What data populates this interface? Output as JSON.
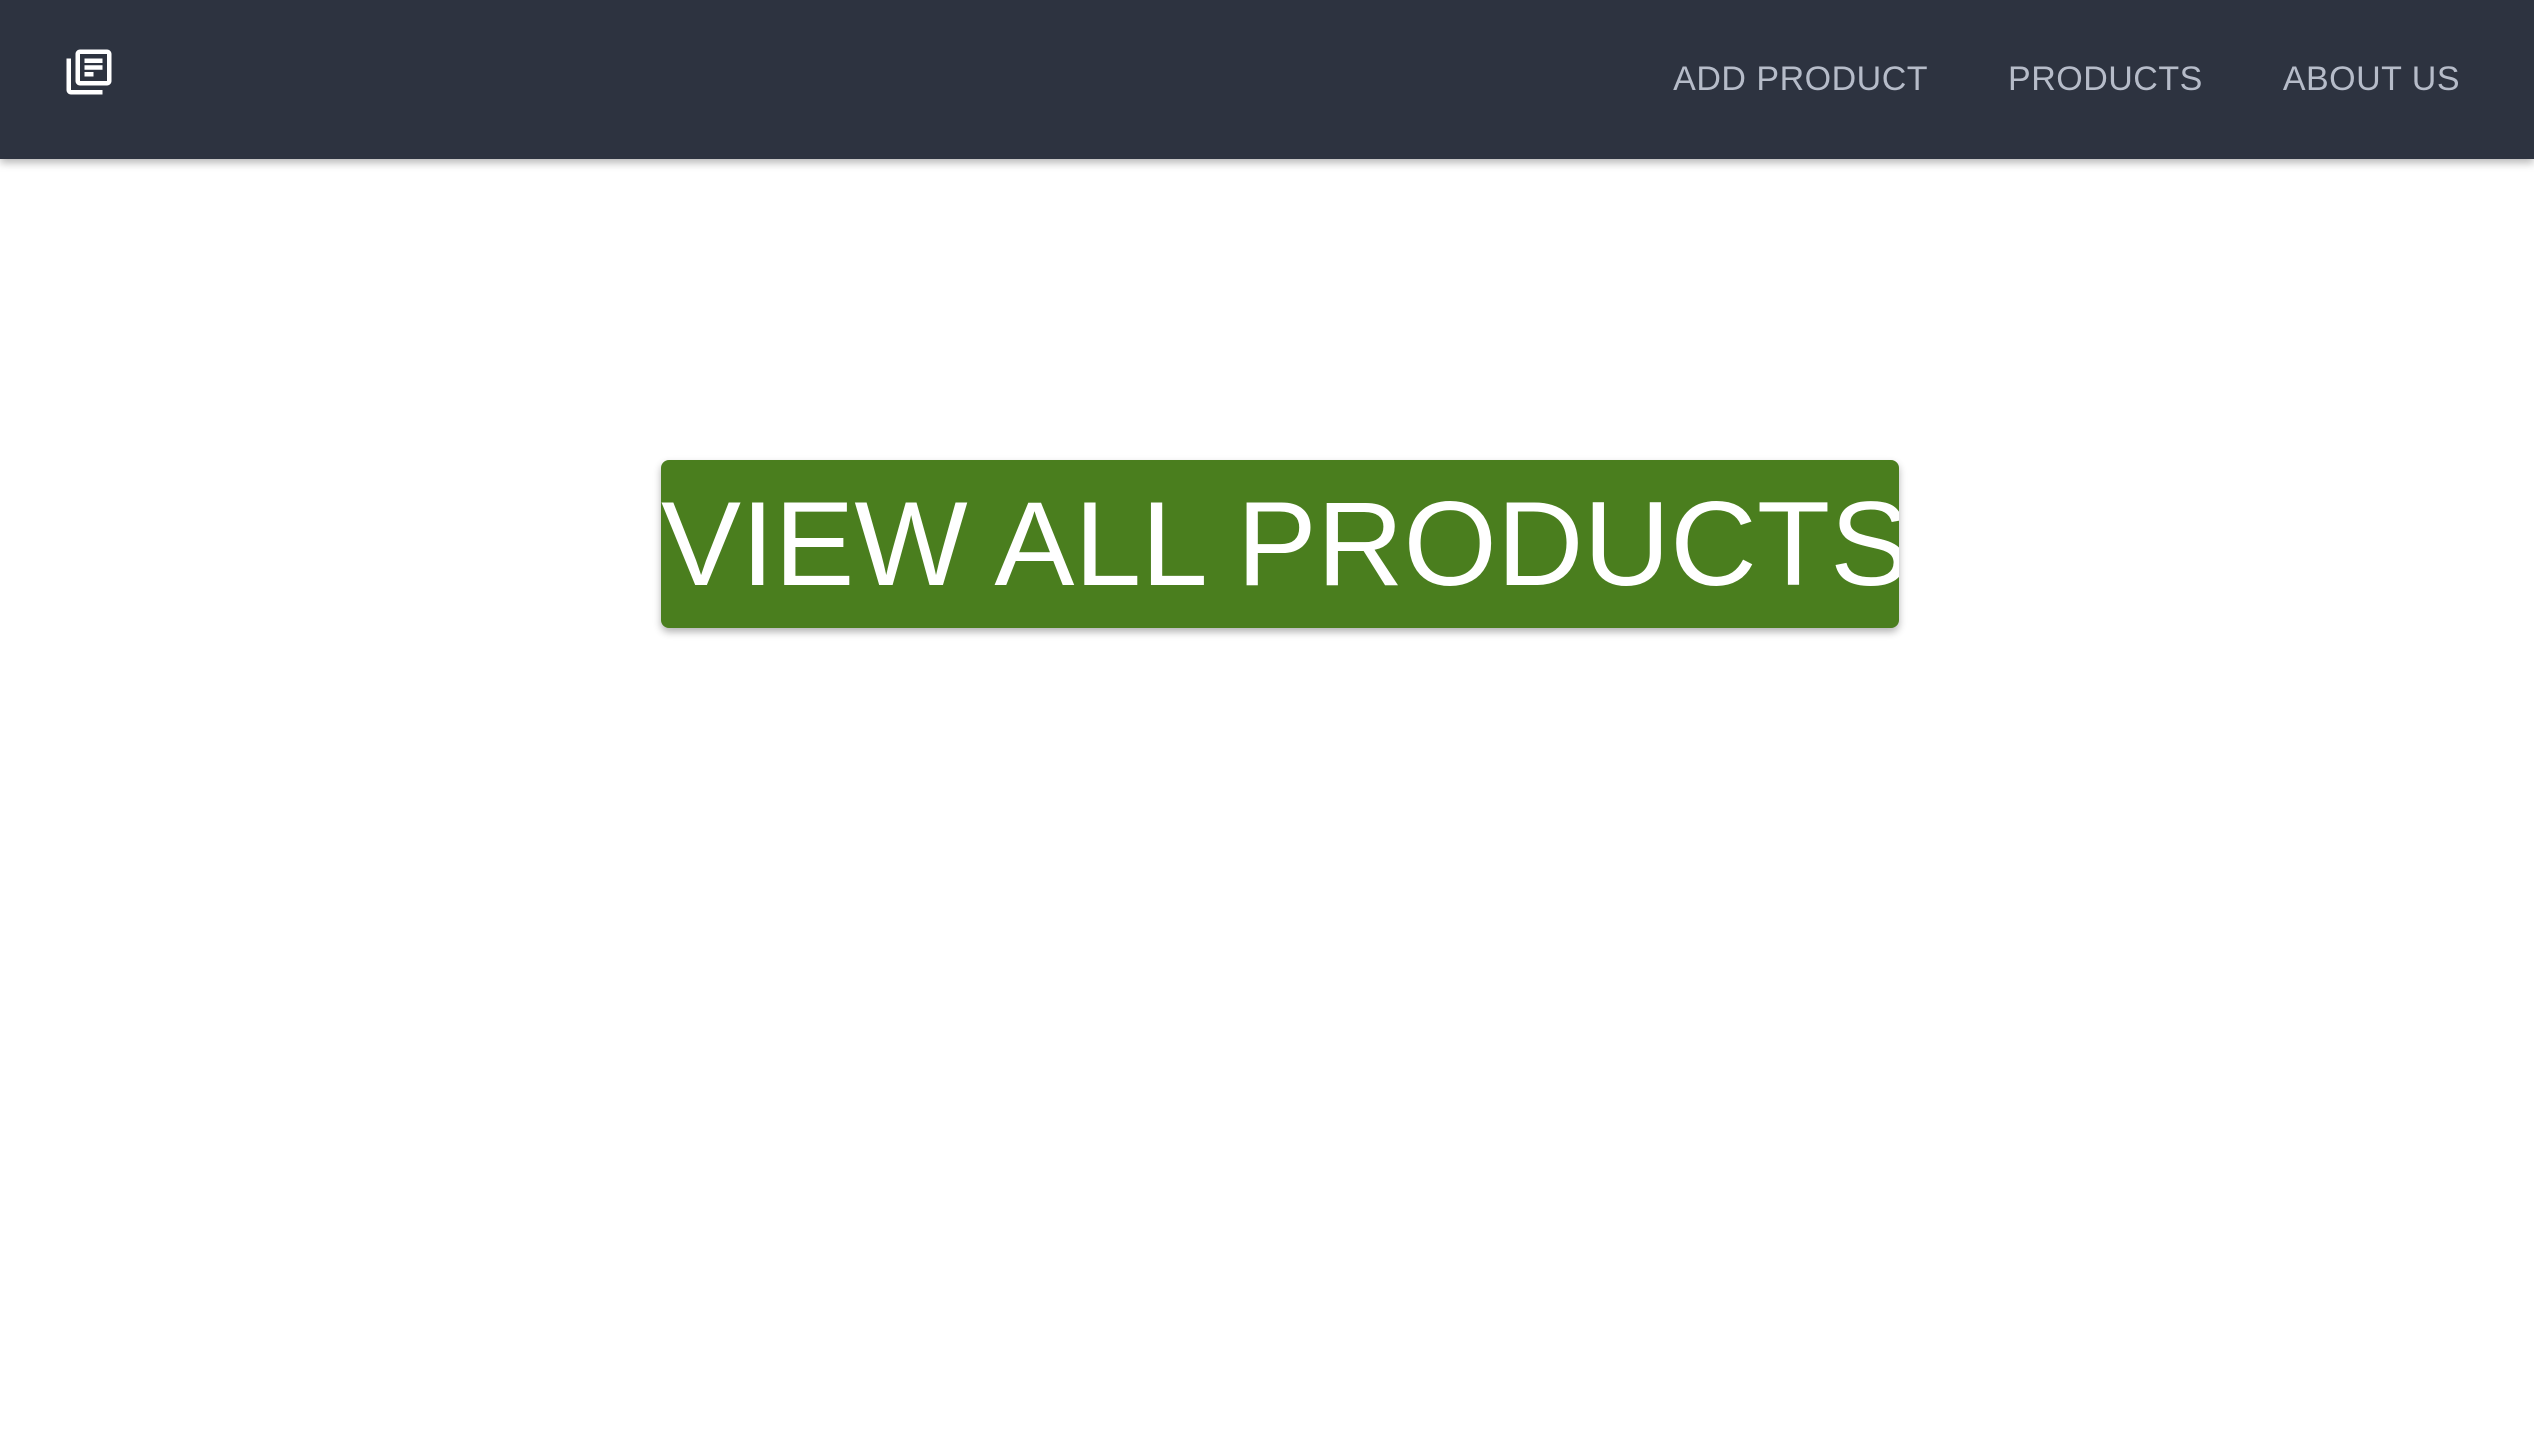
{
  "navbar": {
    "logo_icon": "news-feed-icon",
    "links": [
      {
        "label": "ADD PRODUCT"
      },
      {
        "label": "PRODUCTS"
      },
      {
        "label": "ABOUT US"
      }
    ]
  },
  "main": {
    "cta_label": "VIEW ALL PRODUCTS"
  },
  "colors": {
    "navbar_bg": "#2d3340",
    "nav_text": "#b6bcc9",
    "cta_bg": "#4a7e1e",
    "cta_text": "#ffffff",
    "page_bg": "#ffffff"
  }
}
